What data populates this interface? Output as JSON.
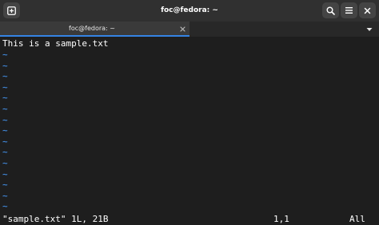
{
  "window": {
    "title": "foc@fedora: ~"
  },
  "tabs": [
    {
      "label": "foc@fedora: ~"
    }
  ],
  "icons": {
    "new_tab": "new-tab-icon",
    "search": "search-icon",
    "menu": "hamburger-menu-icon",
    "close_window": "close-icon",
    "tab_close": "close-icon",
    "tab_menu": "chevron-down-icon"
  },
  "colors": {
    "accent": "#3584e4",
    "tilde": "#3f83d1",
    "terminal_bg": "#1e1e1e"
  },
  "terminal": {
    "first_line": "This is a sample.txt",
    "empty_line_marker": "~",
    "empty_line_count": 15
  },
  "statusline": {
    "file_info": "\"sample.txt\" 1L, 21B",
    "cursor_pos": "1,1",
    "scroll_pos": "All"
  }
}
